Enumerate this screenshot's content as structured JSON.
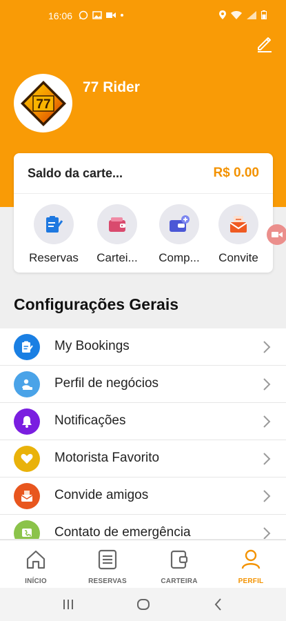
{
  "status_bar": {
    "time": "16:06"
  },
  "profile": {
    "name": "77 Rider",
    "logo_text": "77"
  },
  "wallet": {
    "label": "Saldo da carte...",
    "balance": "R$ 0.00",
    "shortcuts": [
      {
        "label": "Reservas",
        "icon": "clipboard-icon"
      },
      {
        "label": "Cartei...",
        "icon": "wallet-icon"
      },
      {
        "label": "Comp...",
        "icon": "company-card-icon"
      },
      {
        "label": "Convite",
        "icon": "invite-envelope-icon"
      }
    ]
  },
  "settings": {
    "title": "Configurações Gerais",
    "items": [
      {
        "label": "My Bookings",
        "icon": "clipboard-icon",
        "color": "#1a7fe3"
      },
      {
        "label": "Perfil de negócios",
        "icon": "business-profile-icon",
        "color": "#4aa3e8"
      },
      {
        "label": "Notificações",
        "icon": "bell-icon",
        "color": "#7a1ee0"
      },
      {
        "label": "Motorista Favorito",
        "icon": "heart-icon",
        "color": "#e9b20a"
      },
      {
        "label": "Convide amigos",
        "icon": "envelope-icon",
        "color": "#e8561e"
      },
      {
        "label": "Contato de emergência",
        "icon": "emergency-phone-icon",
        "color": "#8bc34a"
      }
    ]
  },
  "bottom_nav": {
    "items": [
      {
        "label": "INÍCIO",
        "icon": "home-icon"
      },
      {
        "label": "RESERVAS",
        "icon": "list-icon"
      },
      {
        "label": "CARTEIRA",
        "icon": "wallet-icon"
      },
      {
        "label": "PERFIL",
        "icon": "person-icon",
        "active": true
      }
    ]
  },
  "colors": {
    "brand": "#f99b06",
    "accent_text": "#f39200"
  }
}
